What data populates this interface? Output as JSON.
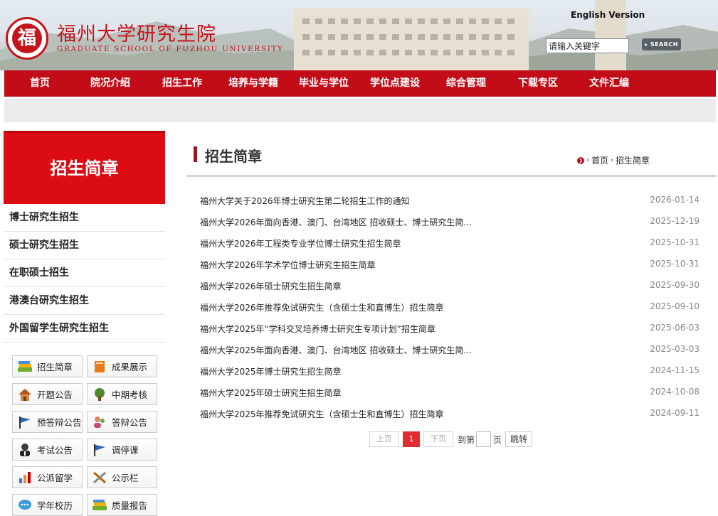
{
  "header": {
    "logo_seal_char": "福",
    "logo_cn": "福州大学研究生院",
    "logo_en": "GRADUATE SCHOOL OF FUZHOU UNIVERSITY",
    "english_version": "English Version",
    "search_placeholder": "请输入关键字",
    "search_button": "SEARCH"
  },
  "nav": {
    "items": [
      "首页",
      "院况介绍",
      "招生工作",
      "培养与学籍",
      "毕业与学位",
      "学位点建设",
      "综合管理",
      "下载专区",
      "文件汇编"
    ]
  },
  "sidebar": {
    "title": "招生简章",
    "items": [
      "博士研究生招生",
      "硕士研究生招生",
      "在职硕士招生",
      "港澳台研究生招生",
      "外国留学生研究生招生"
    ],
    "quick_links": [
      {
        "label": "招生简章",
        "icon": "books-icon"
      },
      {
        "label": "成果展示",
        "icon": "book-icon"
      },
      {
        "label": "开题公告",
        "icon": "house-icon"
      },
      {
        "label": "中期考核",
        "icon": "tree-icon"
      },
      {
        "label": "预答辩公告",
        "icon": "flag-icon"
      },
      {
        "label": "答辩公告",
        "icon": "people-icon"
      },
      {
        "label": "考试公告",
        "icon": "person-icon"
      },
      {
        "label": "调停课",
        "icon": "flag-icon"
      },
      {
        "label": "公派留学",
        "icon": "bar-chart-icon"
      },
      {
        "label": "公示栏",
        "icon": "tools-icon"
      },
      {
        "label": "学年校历",
        "icon": "chat-icon"
      },
      {
        "label": "质量报告",
        "icon": "books-icon"
      }
    ]
  },
  "main": {
    "title": "招生简章",
    "breadcrumb": {
      "home": "首页",
      "current": "招生简章"
    },
    "news": [
      {
        "title": "福州大学关于2026年博士研究生第二轮招生工作的通知",
        "date": "2026-01-14"
      },
      {
        "title": "福州大学2026年面向香港、澳门、台湾地区 招收硕士、博士研究生简...",
        "date": "2025-12-19"
      },
      {
        "title": "福州大学2026年工程类专业学位博士研究生招生简章",
        "date": "2025-10-31"
      },
      {
        "title": "福州大学2026年学术学位博士研究生招生简章",
        "date": "2025-10-31"
      },
      {
        "title": "福州大学2026年硕士研究生招生简章",
        "date": "2025-09-30"
      },
      {
        "title": "福州大学2026年推荐免试研究生（含硕士生和直博生）招生简章",
        "date": "2025-09-10"
      },
      {
        "title": "福州大学2025年“学科交叉培养博士研究生专项计划”招生简章",
        "date": "2025-06-03"
      },
      {
        "title": "福州大学2025年面向香港、澳门、台湾地区 招收硕士、博士研究生简...",
        "date": "2025-03-03"
      },
      {
        "title": "福州大学2025年博士研究生招生简章",
        "date": "2024-11-15"
      },
      {
        "title": "福州大学2025年硕士研究生招生简章",
        "date": "2024-10-08"
      },
      {
        "title": "福州大学2025年推荐免试研究生（含硕士生和直博生）招生简章",
        "date": "2024-09-11"
      }
    ],
    "pagination": {
      "prev": "上页",
      "current": "1",
      "next": "下页",
      "goto_prefix": "到第",
      "goto_suffix": "页",
      "go_button": "跳转"
    }
  },
  "colors": {
    "primary_red": "#c20d18",
    "sidebar_red": "#dc0c14",
    "date_gray": "#888888"
  }
}
